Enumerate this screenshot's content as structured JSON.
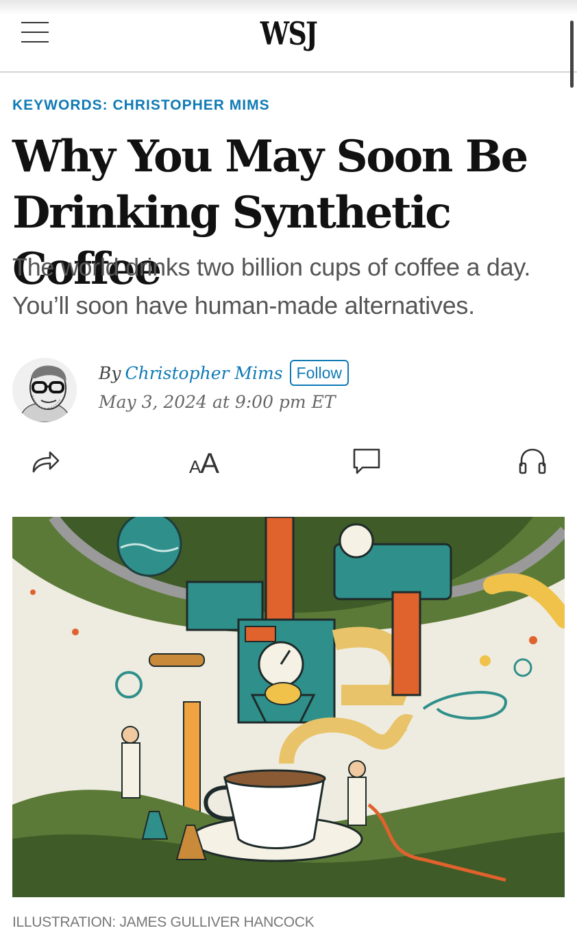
{
  "header": {
    "logo": "WSJ"
  },
  "article": {
    "keywords": "KEYWORDS: CHRISTOPHER MIMS",
    "headline": "Why You May Soon Be Drinking Synthetic Coffee",
    "dek": "The world drinks two billion cups of coffee a day. You’ll soon have human-made alternatives.",
    "byline_prefix": "By",
    "author": "Christopher Mims",
    "follow_label": "Follow",
    "date": "May 3, 2024 at 9:00 pm ET",
    "image_caption": "ILLUSTRATION: JAMES GULLIVER HANCOCK"
  },
  "actions": {
    "share_icon": "share-arrow-icon",
    "text_size_icon": "text-size-icon",
    "text_size_glyph": "AA",
    "comments_icon": "comment-bubble-icon",
    "listen_icon": "headphones-icon"
  },
  "colors": {
    "accent": "#0f7ab5",
    "headline": "#111111",
    "dek": "#555555",
    "caption": "#777777"
  }
}
